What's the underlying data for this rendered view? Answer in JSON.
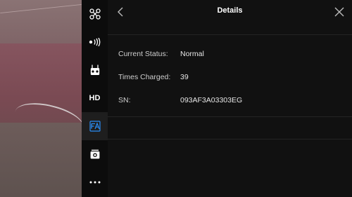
{
  "sidebar": {
    "items": [
      {
        "icon": "aircraft-icon"
      },
      {
        "icon": "signal-transmission-icon"
      },
      {
        "icon": "remote-controller-icon"
      },
      {
        "icon": "hd-icon",
        "label": "HD"
      },
      {
        "icon": "battery-settings-icon"
      },
      {
        "icon": "camera-icon"
      },
      {
        "icon": "more-icon"
      }
    ],
    "active_index": 4
  },
  "header": {
    "title": "Details"
  },
  "details": {
    "rows": [
      {
        "label": "Current Status:",
        "value": "Normal"
      },
      {
        "label": "Times Charged:",
        "value": "39"
      },
      {
        "label": "SN:",
        "value": "093AF3A03303EG"
      }
    ]
  },
  "colors": {
    "accent": "#2a8df5",
    "panel_bg": "#111111",
    "sidebar_bg": "#0c0c0c"
  }
}
